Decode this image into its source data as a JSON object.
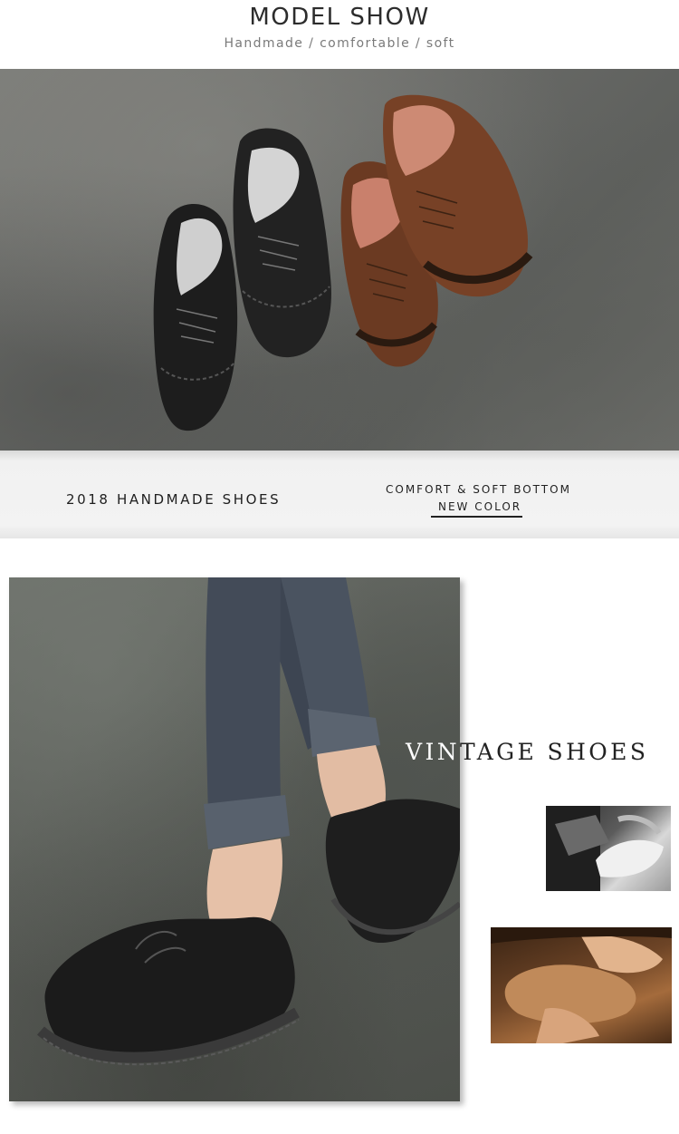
{
  "header": {
    "title": "MODEL SHOW",
    "subtitle": "Handmade / comfortable / soft"
  },
  "hero": {
    "image": "four-leather-lace-up-shoes-black-and-brown-on-grey-backdrop"
  },
  "band": {
    "left_text": "2018 HANDMADE SHOES",
    "right_line1": "COMFORT & SOFT BOTTOM",
    "right_line2": "NEW COLOR"
  },
  "model": {
    "image": "model-wearing-black-lace-up-shoes-and-cuffed-jeans"
  },
  "vintage": {
    "part_on_photo": "VIN",
    "part_off_photo": "TAGE SHOES"
  },
  "thumbnails": [
    {
      "image": "shoe-being-sewn-on-machine-monochrome"
    },
    {
      "image": "hands-crafting-tan-leather-shoe"
    }
  ],
  "colors": {
    "title_text": "#2c2c2c",
    "subtitle_text": "#7a7a7a",
    "band_background": "#f1f1f1",
    "black_leather": "#1c1c1c",
    "brown_leather": "#6b3a22"
  }
}
